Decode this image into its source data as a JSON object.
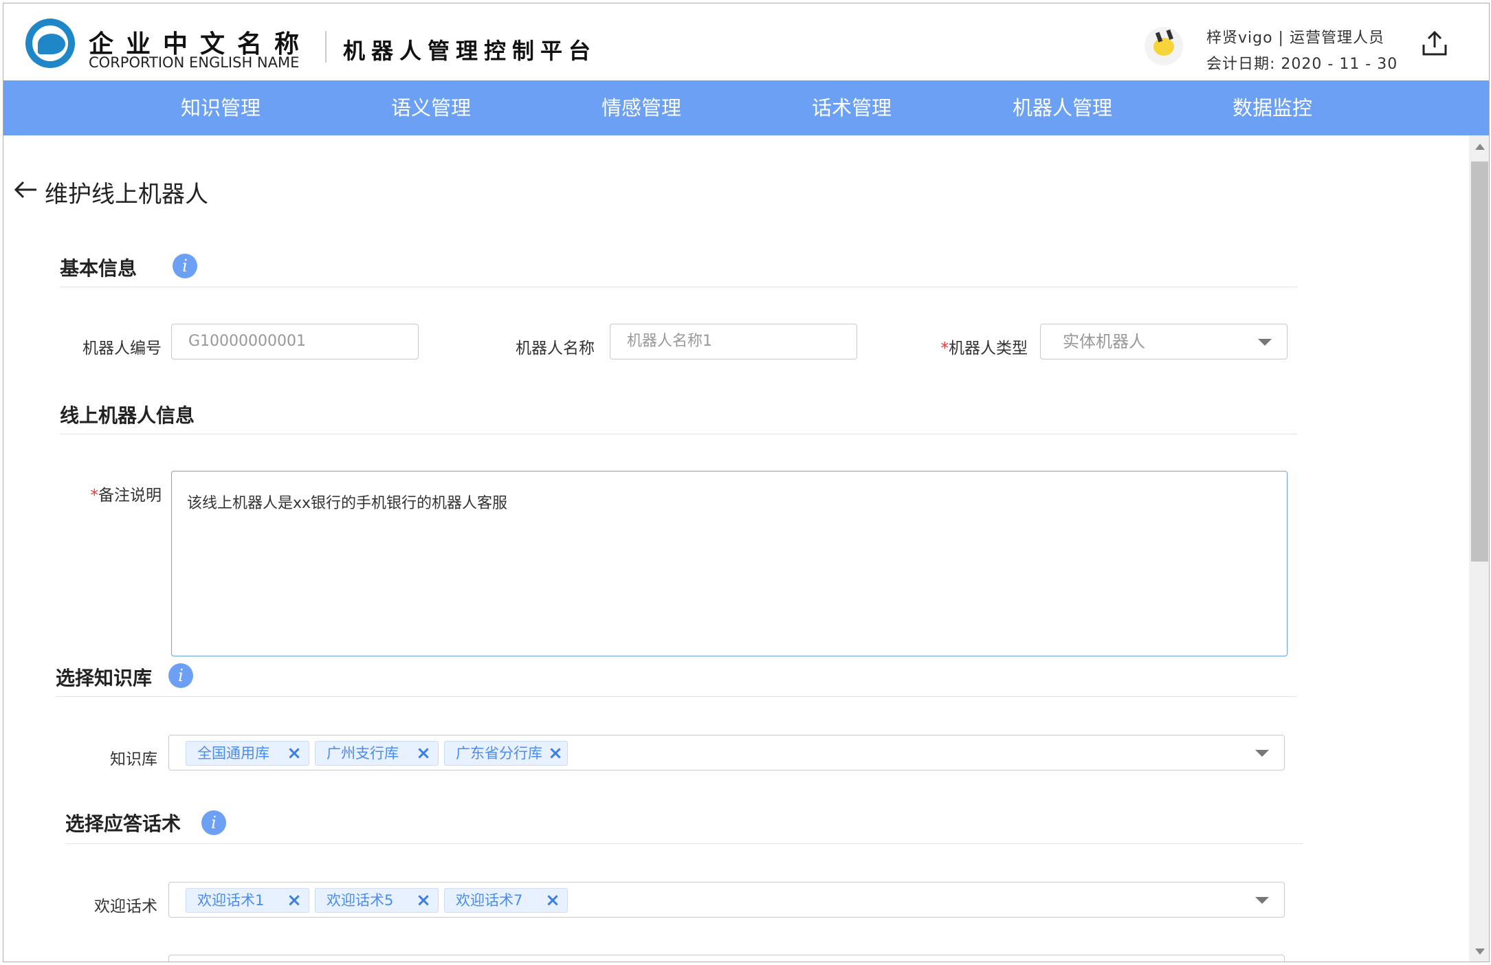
{
  "header": {
    "company_cn": "企业中文名称",
    "company_en": "CORPORTION ENGLISH NAME",
    "platform_title": "机器人管理控制平台",
    "user_info": "梓贤vigo | 运营管理人员",
    "date_info": "会计日期: 2020 - 11 - 30"
  },
  "nav": {
    "items": [
      {
        "label": "知识管理"
      },
      {
        "label": "语义管理"
      },
      {
        "label": "情感管理"
      },
      {
        "label": "话术管理"
      },
      {
        "label": "机器人管理"
      },
      {
        "label": "数据监控"
      }
    ]
  },
  "page": {
    "title": "维护线上机器人"
  },
  "basic_info": {
    "title": "基本信息",
    "robot_id_label": "机器人编号",
    "robot_id_value": "G10000000001",
    "robot_name_label": "机器人名称",
    "robot_name_placeholder": "机器人名称1",
    "robot_type_required": "*",
    "robot_type_label": "机器人类型",
    "robot_type_value": "实体机器人"
  },
  "online_info": {
    "title": "线上机器人信息",
    "remark_required": "*",
    "remark_label": "备注说明",
    "remark_value": "该线上机器人是xx银行的手机银行的机器人客服"
  },
  "knowledge": {
    "title": "选择知识库",
    "label": "知识库",
    "tags": [
      {
        "label": "全国通用库"
      },
      {
        "label": "广州支行库"
      },
      {
        "label": "广东省分行库"
      }
    ]
  },
  "reply": {
    "title": "选择应答话术",
    "welcome_label": "欢迎话术",
    "tags": [
      {
        "label": "欢迎话术1"
      },
      {
        "label": "欢迎话术5"
      },
      {
        "label": "欢迎话术7"
      }
    ]
  },
  "colors": {
    "nav_bg": "#6ca0f4",
    "tag_text": "#4a8cf0",
    "required": "#e33333"
  },
  "icons": {
    "logo": "company-logo",
    "avatar": "pikachu-avatar",
    "share": "upload-icon",
    "back": "back-arrow-icon",
    "info": "info-icon",
    "close": "close-icon",
    "dropdown": "chevron-down-icon"
  }
}
